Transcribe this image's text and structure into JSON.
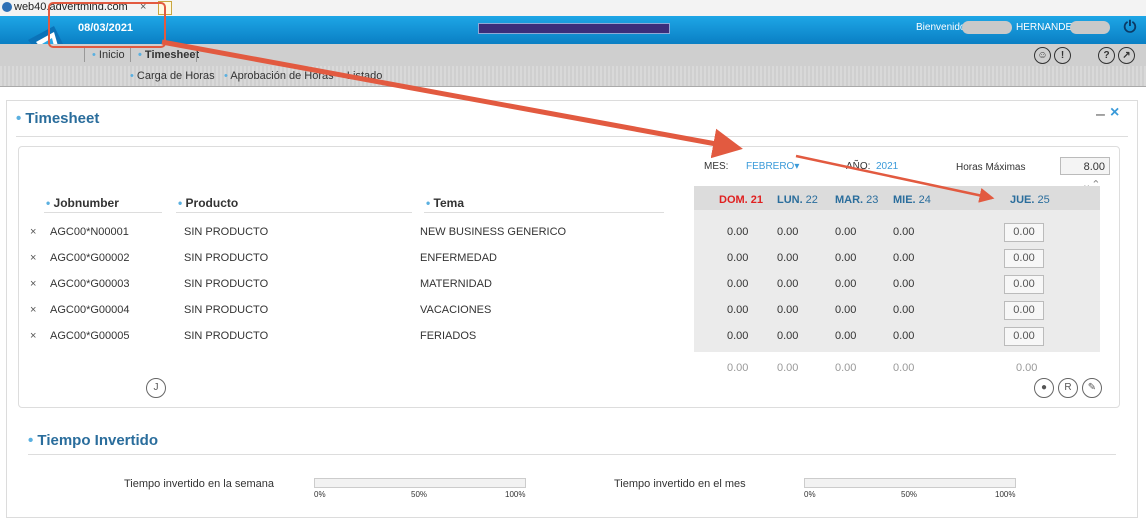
{
  "browser": {
    "tab_url": "web40.advertmind.com",
    "tab_close": "×"
  },
  "header": {
    "date": "08/03/2021",
    "welcome": "Bienvenido",
    "user_name": "HERNANDEZ",
    "power_icon": "power-icon"
  },
  "nav": {
    "primary": [
      "Inicio",
      "Timesheet"
    ],
    "secondary": [
      "Carga de Horas",
      "Aprobación de Horas",
      "Listado"
    ],
    "right_icons": [
      "smiley-icon",
      "alert-icon",
      "help-icon",
      "compass-icon"
    ]
  },
  "timesheet": {
    "title": "Timesheet",
    "minimize": "–",
    "close": "×",
    "mes_label": "MES:",
    "mes_value": "FEBRERO",
    "anio_label": "AÑO:",
    "anio_value": "2021",
    "horas_label": "Horas Máximas",
    "horas_value": "8.00",
    "columns": {
      "jobnumber": "Jobnumber",
      "producto": "Producto",
      "tema": "Tema"
    },
    "days": [
      {
        "name": "DOM.",
        "num": "21",
        "highlight": true
      },
      {
        "name": "LUN.",
        "num": "22"
      },
      {
        "name": "MAR.",
        "num": "23"
      },
      {
        "name": "MIE.",
        "num": "24"
      },
      {
        "name": "JUE.",
        "num": "25"
      }
    ],
    "rows": [
      {
        "job": "AGC00*N00001",
        "producto": "SIN PRODUCTO",
        "tema": "NEW BUSINESS GENERICO",
        "hours": [
          "0.00",
          "0.00",
          "0.00",
          "0.00",
          "0.00"
        ]
      },
      {
        "job": "AGC00*G00002",
        "producto": "SIN PRODUCTO",
        "tema": "ENFERMEDAD",
        "hours": [
          "0.00",
          "0.00",
          "0.00",
          "0.00",
          "0.00"
        ]
      },
      {
        "job": "AGC00*G00003",
        "producto": "SIN PRODUCTO",
        "tema": "MATERNIDAD",
        "hours": [
          "0.00",
          "0.00",
          "0.00",
          "0.00",
          "0.00"
        ]
      },
      {
        "job": "AGC00*G00004",
        "producto": "SIN PRODUCTO",
        "tema": "VACACIONES",
        "hours": [
          "0.00",
          "0.00",
          "0.00",
          "0.00",
          "0.00"
        ]
      },
      {
        "job": "AGC00*G00005",
        "producto": "SIN PRODUCTO",
        "tema": "FERIADOS",
        "hours": [
          "0.00",
          "0.00",
          "0.00",
          "0.00",
          "0.00"
        ]
      }
    ],
    "totals": [
      "0.00",
      "0.00",
      "0.00",
      "0.00",
      "0.00"
    ],
    "j_button": "J",
    "r_button": "R"
  },
  "tiempo": {
    "title": "Tiempo Invertido",
    "semana_label": "Tiempo invertido en la semana",
    "mes_label": "Tiempo invertido en el mes",
    "semana_value": 0,
    "mes_value": 0,
    "ticks": [
      "0%",
      "50%",
      "100%"
    ]
  },
  "colors": {
    "accent": "#1ea6e6",
    "title": "#2a6d9c",
    "highlight_day": "#e02020",
    "annotation": "#e25a40"
  }
}
